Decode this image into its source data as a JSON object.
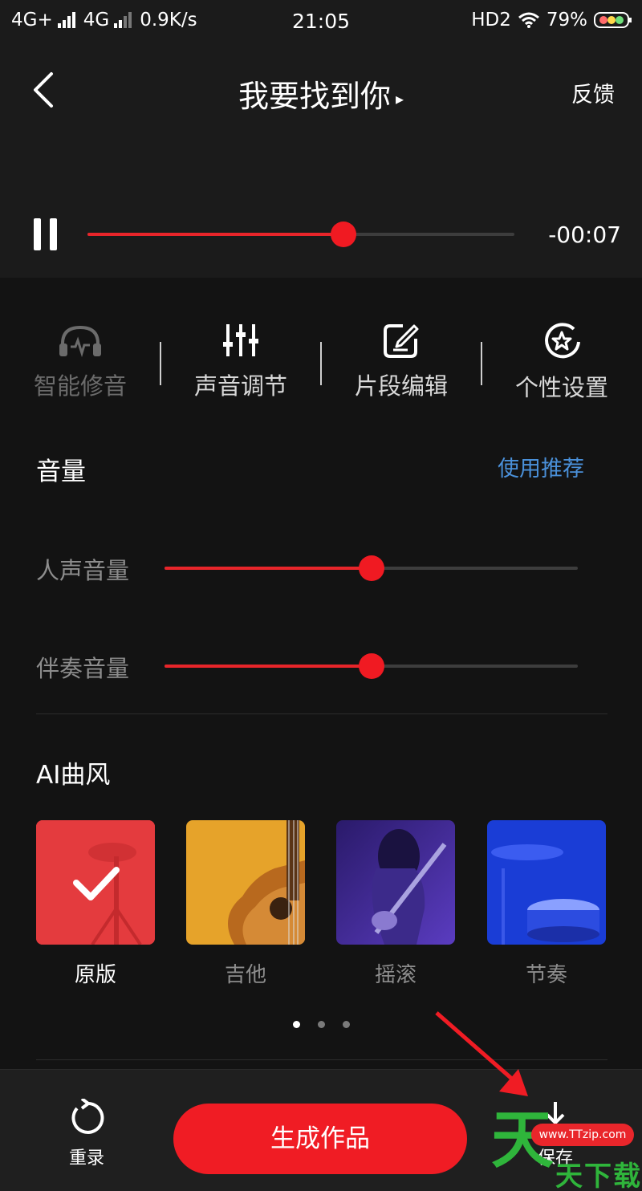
{
  "status_bar": {
    "network1": "4G+",
    "network2": "4G",
    "speed": "0.9K/s",
    "time": "21:05",
    "hd": "HD2",
    "battery": "79%"
  },
  "header": {
    "title": "我要找到你",
    "title_arrow": "▸",
    "feedback_label": "反馈"
  },
  "player": {
    "progress": 0.6,
    "remaining": "-00:07"
  },
  "tabs": [
    {
      "label": "智能修音",
      "icon": "headphones-pulse-icon",
      "active": false
    },
    {
      "label": "声音调节",
      "icon": "equalizer-sliders-icon",
      "active": true
    },
    {
      "label": "片段编辑",
      "icon": "edit-square-icon",
      "active": true
    },
    {
      "label": "个性设置",
      "icon": "star-badge-icon",
      "active": true
    }
  ],
  "volume": {
    "title": "音量",
    "recommend_label": "使用推荐",
    "vocal_label": "人声音量",
    "vocal_level": 0.5,
    "accomp_label": "伴奏音量",
    "accomp_level": 0.5
  },
  "ai_style": {
    "title": "AI曲风",
    "items": [
      {
        "label": "原版",
        "selected": true
      },
      {
        "label": "吉他",
        "selected": false
      },
      {
        "label": "摇滚",
        "selected": false
      },
      {
        "label": "节奏",
        "selected": false
      }
    ],
    "page": 1,
    "pages": 3
  },
  "bottom": {
    "redo_label": "重录",
    "generate_label": "生成作品",
    "save_label": "保存"
  },
  "watermark": {
    "pill": "www.TTzip.com",
    "big": "天",
    "rest": "天下载"
  },
  "colors": {
    "accent": "#f01c24",
    "link": "#4a90d9",
    "background": "#131313"
  }
}
